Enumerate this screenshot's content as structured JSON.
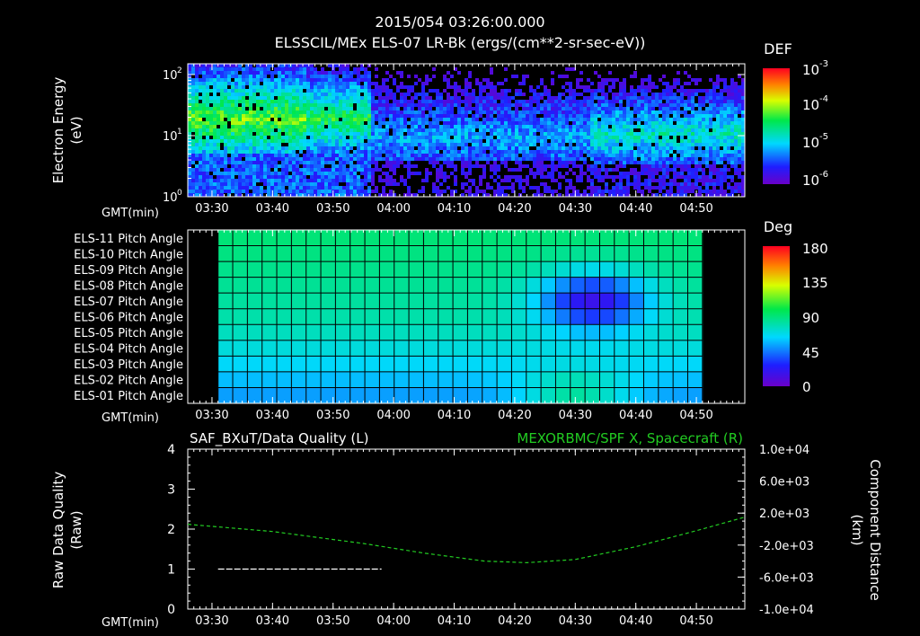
{
  "header": {
    "timestamp": "2015/054 03:26:00.000",
    "title": "ELSSCIL/MEx ELS-07 LR-Bk  (ergs/(cm**2-sr-sec-eV))"
  },
  "colors": {
    "background": "#000000",
    "axis": "#ffffff",
    "grid": "#000000",
    "green_series": "#22cc22"
  },
  "time_axis": {
    "label": "GMT(min)",
    "ticks": [
      "03:30",
      "03:40",
      "03:50",
      "04:00",
      "04:10",
      "04:20",
      "04:30",
      "04:40",
      "04:50"
    ]
  },
  "chart_data": [
    {
      "type": "heatmap",
      "id": "electron-spectrogram",
      "title": "ELSSCIL/MEx ELS-07 LR-Bk  (ergs/(cm**2-sr-sec-eV))",
      "ylabel": [
        "Electron Energy",
        "(eV)"
      ],
      "xlabel": "GMT(min)",
      "y_scale": "log",
      "ylim": [
        1,
        150
      ],
      "y_ticks": [
        "10^0",
        "10^1",
        "10^2"
      ],
      "xlim_minutes": [
        "03:26",
        "03:58"
      ],
      "colorbar": {
        "label": "DEF",
        "scale": "log",
        "range": [
          1e-06,
          0.001
        ],
        "ticks": [
          {
            "base": "10",
            "exp": "-3"
          },
          {
            "base": "10",
            "exp": "-4"
          },
          {
            "base": "10",
            "exp": "-5"
          },
          {
            "base": "10",
            "exp": "-6"
          }
        ]
      },
      "description_regions": [
        {
          "time": [
            "03:26",
            "03:55"
          ],
          "energy_peak_eV": 20,
          "level": "high"
        },
        {
          "time": [
            "04:10",
            "04:32"
          ],
          "energy_peak_eV": 10,
          "level": "low"
        },
        {
          "time": [
            "04:32",
            "04:58"
          ],
          "energy_peak_eV": 10,
          "level": "medium"
        }
      ]
    },
    {
      "type": "heatmap",
      "id": "pitch-angle-map",
      "row_labels": [
        "ELS-11 Pitch Angle",
        "ELS-10 Pitch Angle",
        "ELS-09 Pitch Angle",
        "ELS-08 Pitch Angle",
        "ELS-07 Pitch Angle",
        "ELS-06 Pitch Angle",
        "ELS-05 Pitch Angle",
        "ELS-04 Pitch Angle",
        "ELS-03 Pitch Angle",
        "ELS-02 Pitch Angle",
        "ELS-01 Pitch Angle"
      ],
      "xlabel": "GMT(min)",
      "data_time_range": [
        "03:31",
        "04:51"
      ],
      "colorbar": {
        "label": "Deg",
        "range": [
          0,
          180
        ],
        "ticks": [
          "180",
          "135",
          "90",
          "45",
          "0"
        ]
      },
      "baseline_deg": [
        90,
        88,
        86,
        84,
        82,
        80,
        76,
        70,
        64,
        58,
        52
      ],
      "anomaly": {
        "center": "04:33",
        "rows": [
          "ELS-08",
          "ELS-06"
        ],
        "min_deg": 20
      },
      "bottom_bump": {
        "center": "04:30",
        "rows": [
          "ELS-02",
          "ELS-01"
        ],
        "max_deg": 85
      }
    },
    {
      "type": "line",
      "id": "data-quality-and-distance",
      "title_left": "SAF_BXuT/Data Quality (L)",
      "title_right": "MEXORBMC/SPF X, Spacecraft (R)",
      "ylabel_left": [
        "Raw Data Quality",
        "(Raw)"
      ],
      "ylabel_right": [
        "Component Distance",
        "(km)"
      ],
      "xlabel": "GMT(min)",
      "ylim_left": [
        0,
        4
      ],
      "y_ticks_left": [
        "0",
        "1",
        "2",
        "3",
        "4"
      ],
      "ylim_right": [
        -10000,
        10000
      ],
      "y_ticks_right": [
        "1.0e+04",
        "6.0e+03",
        "2.0e+03",
        "-2.0e+03",
        "-6.0e+03",
        "-1.0e+04"
      ],
      "series": [
        {
          "name": "SAF_BXuT/Data Quality",
          "axis": "left",
          "color": "#ffffff",
          "segments": [
            {
              "x": [
                "03:31",
                "03:58"
              ],
              "y": 1
            },
            {
              "x": [
                "03:58",
                "04:51"
              ],
              "y": 0
            }
          ]
        },
        {
          "name": "MEXORBMC/SPF X, Spacecraft",
          "axis": "right",
          "color": "#22cc22",
          "x": [
            "03:26",
            "03:40",
            "03:55",
            "04:05",
            "04:15",
            "04:22",
            "04:30",
            "04:40",
            "04:50",
            "04:58"
          ],
          "y": [
            600,
            -300,
            -1800,
            -3000,
            -4000,
            -4200,
            -3800,
            -2200,
            -200,
            1500
          ]
        }
      ]
    }
  ]
}
